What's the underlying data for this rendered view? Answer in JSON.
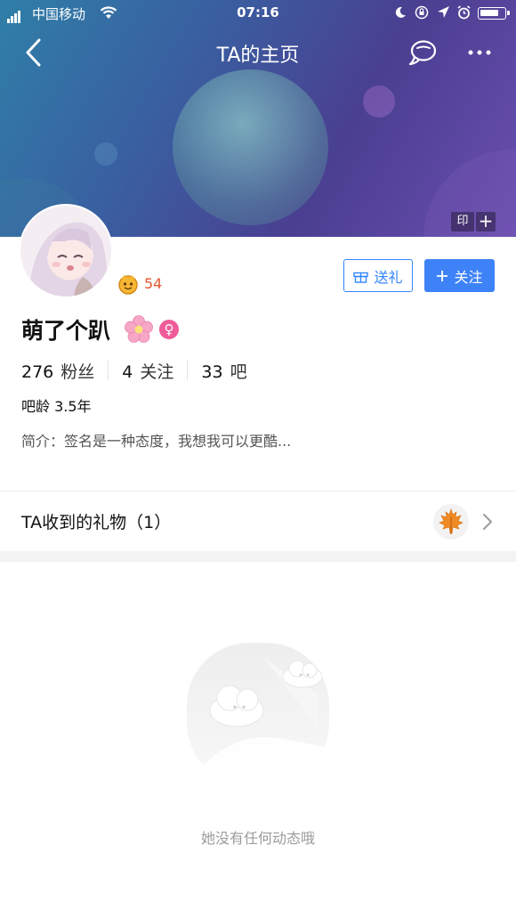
{
  "status_bar": {
    "carrier": "中国移动",
    "time": "07:16"
  },
  "nav": {
    "title": "TA的主页",
    "back_icon": "chevron-left-icon",
    "chat_icon": "chat-bubble-icon",
    "more_icon": "more-dots-icon"
  },
  "banner": {
    "seal_label": "印",
    "plus_label": "+"
  },
  "profile": {
    "level": "54",
    "username": "萌了个趴",
    "gender_symbol": "♀",
    "stats": [
      {
        "num": "276",
        "label": "粉丝"
      },
      {
        "num": "4",
        "label": "关注"
      },
      {
        "num": "33",
        "label": "吧"
      }
    ],
    "age_label": "吧龄 3.5年",
    "intro": "简介：签名是一种态度，我想我可以更酷..."
  },
  "actions": {
    "gift_label": "送礼",
    "follow_label": "关注"
  },
  "gifts": {
    "title": "TA收到的礼物（1）"
  },
  "empty_state": {
    "message": "她没有任何动态哦"
  },
  "colors": {
    "accent": "#3d83f7",
    "level": "#e4572e",
    "gender": "#f05b9a"
  }
}
